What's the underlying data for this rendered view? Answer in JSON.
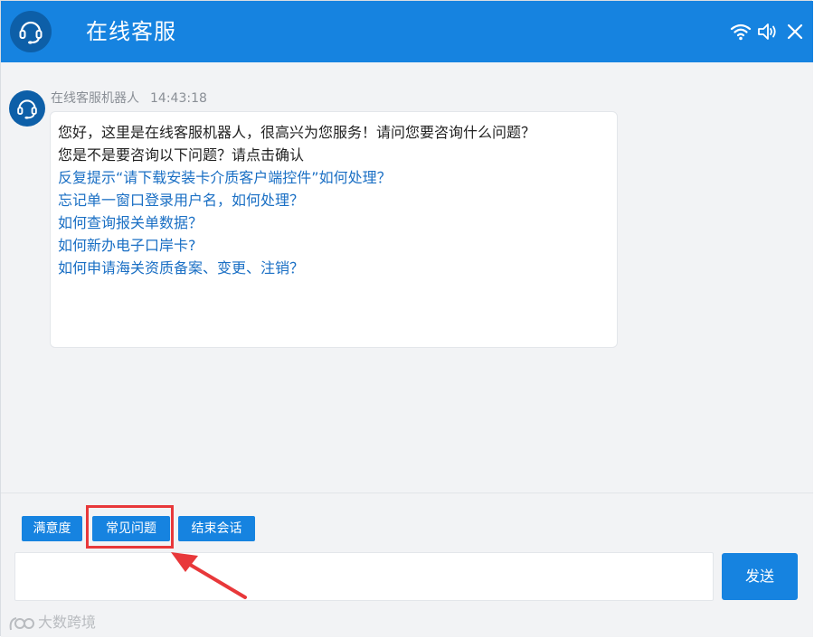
{
  "header": {
    "title": "在线客服",
    "avatar_icon": "headset-icon",
    "icons": [
      "wifi-icon",
      "volume-icon",
      "close-icon"
    ],
    "background": "#1683e0"
  },
  "chat": {
    "messages": [
      {
        "sender": "在线客服机器人",
        "time": "14:43:18",
        "lines": [
          "您好，这里是在线客服机器人，很高兴为您服务！请问您要咨询什么问题？",
          "您是不是要咨询以下问题？请点击确认"
        ],
        "suggestions": [
          "反复提示“请下载安装卡介质客户端控件”如何处理？",
          "忘记单一窗口登录用户名，如何处理？",
          "如何查询报关单数据？",
          "如何新办电子口岸卡?",
          "如何申请海关资质备案、变更、注销？"
        ]
      }
    ]
  },
  "toolbar": {
    "satisfaction_label": "满意度",
    "faq_label": "常见问题",
    "end_session_label": "结束会话",
    "highlight_color": "#e8383a"
  },
  "input": {
    "value": "",
    "placeholder": ""
  },
  "send_label": "发送",
  "watermark": {
    "text": "大数跨境"
  }
}
